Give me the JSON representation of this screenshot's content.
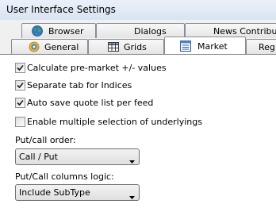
{
  "window": {
    "title": "User Interface Settings"
  },
  "tabs": {
    "back_row": [
      {
        "label": "Browser",
        "icon": "globe-icon"
      },
      {
        "label": "Dialogs"
      },
      {
        "label": "News Contributors"
      }
    ],
    "front_row": [
      {
        "label": "General",
        "icon": "general-settings-icon"
      },
      {
        "label": "Grids",
        "icon": "grid-icon"
      },
      {
        "label": "Market",
        "icon": "market-icon",
        "selected": true
      },
      {
        "label": "Reg"
      }
    ]
  },
  "market": {
    "options": [
      {
        "label": "Calculate pre-market +/- values",
        "checked": true
      },
      {
        "label": "Separate tab for Indices",
        "checked": true
      },
      {
        "label": "Auto save quote list per feed",
        "checked": true
      },
      {
        "label": "Enable multiple selection of underlyings",
        "checked": false
      }
    ],
    "putcall_order": {
      "label": "Put/call order:",
      "value": "Call / Put"
    },
    "columns_logic": {
      "label": "Put/Call columns logic:",
      "value": "Include SubType"
    }
  },
  "colors": {
    "tab_border": "#898c95",
    "content_bg": "#ffffff",
    "titlebar_bg": "#dfe8f4"
  }
}
